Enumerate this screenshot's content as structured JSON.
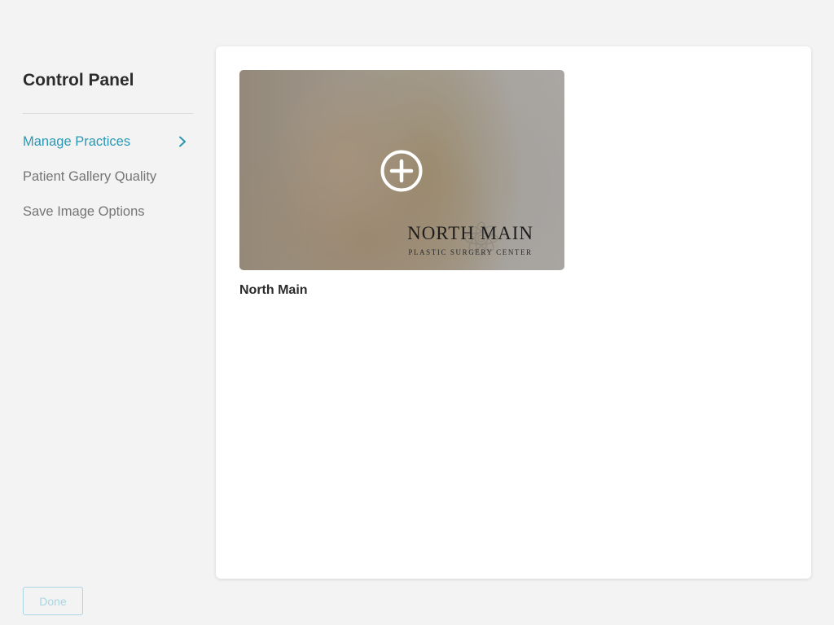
{
  "sidebar": {
    "title": "Control Panel",
    "items": [
      {
        "label": "Manage Practices",
        "active": true
      },
      {
        "label": "Patient Gallery Quality",
        "active": false
      },
      {
        "label": "Save Image Options",
        "active": false
      }
    ],
    "done_label": "Done"
  },
  "main": {
    "practices": [
      {
        "name": "North Main",
        "logo_title": "NORTH MAIN",
        "logo_subtitle": "PLASTIC SURGERY CENTER",
        "action_icon": "plus-circle-icon"
      }
    ]
  },
  "colors": {
    "accent": "#2b97b3",
    "background": "#f3f3f3",
    "panel": "#ffffff",
    "muted_text": "#757575",
    "done_border": "#a9d6e2"
  }
}
